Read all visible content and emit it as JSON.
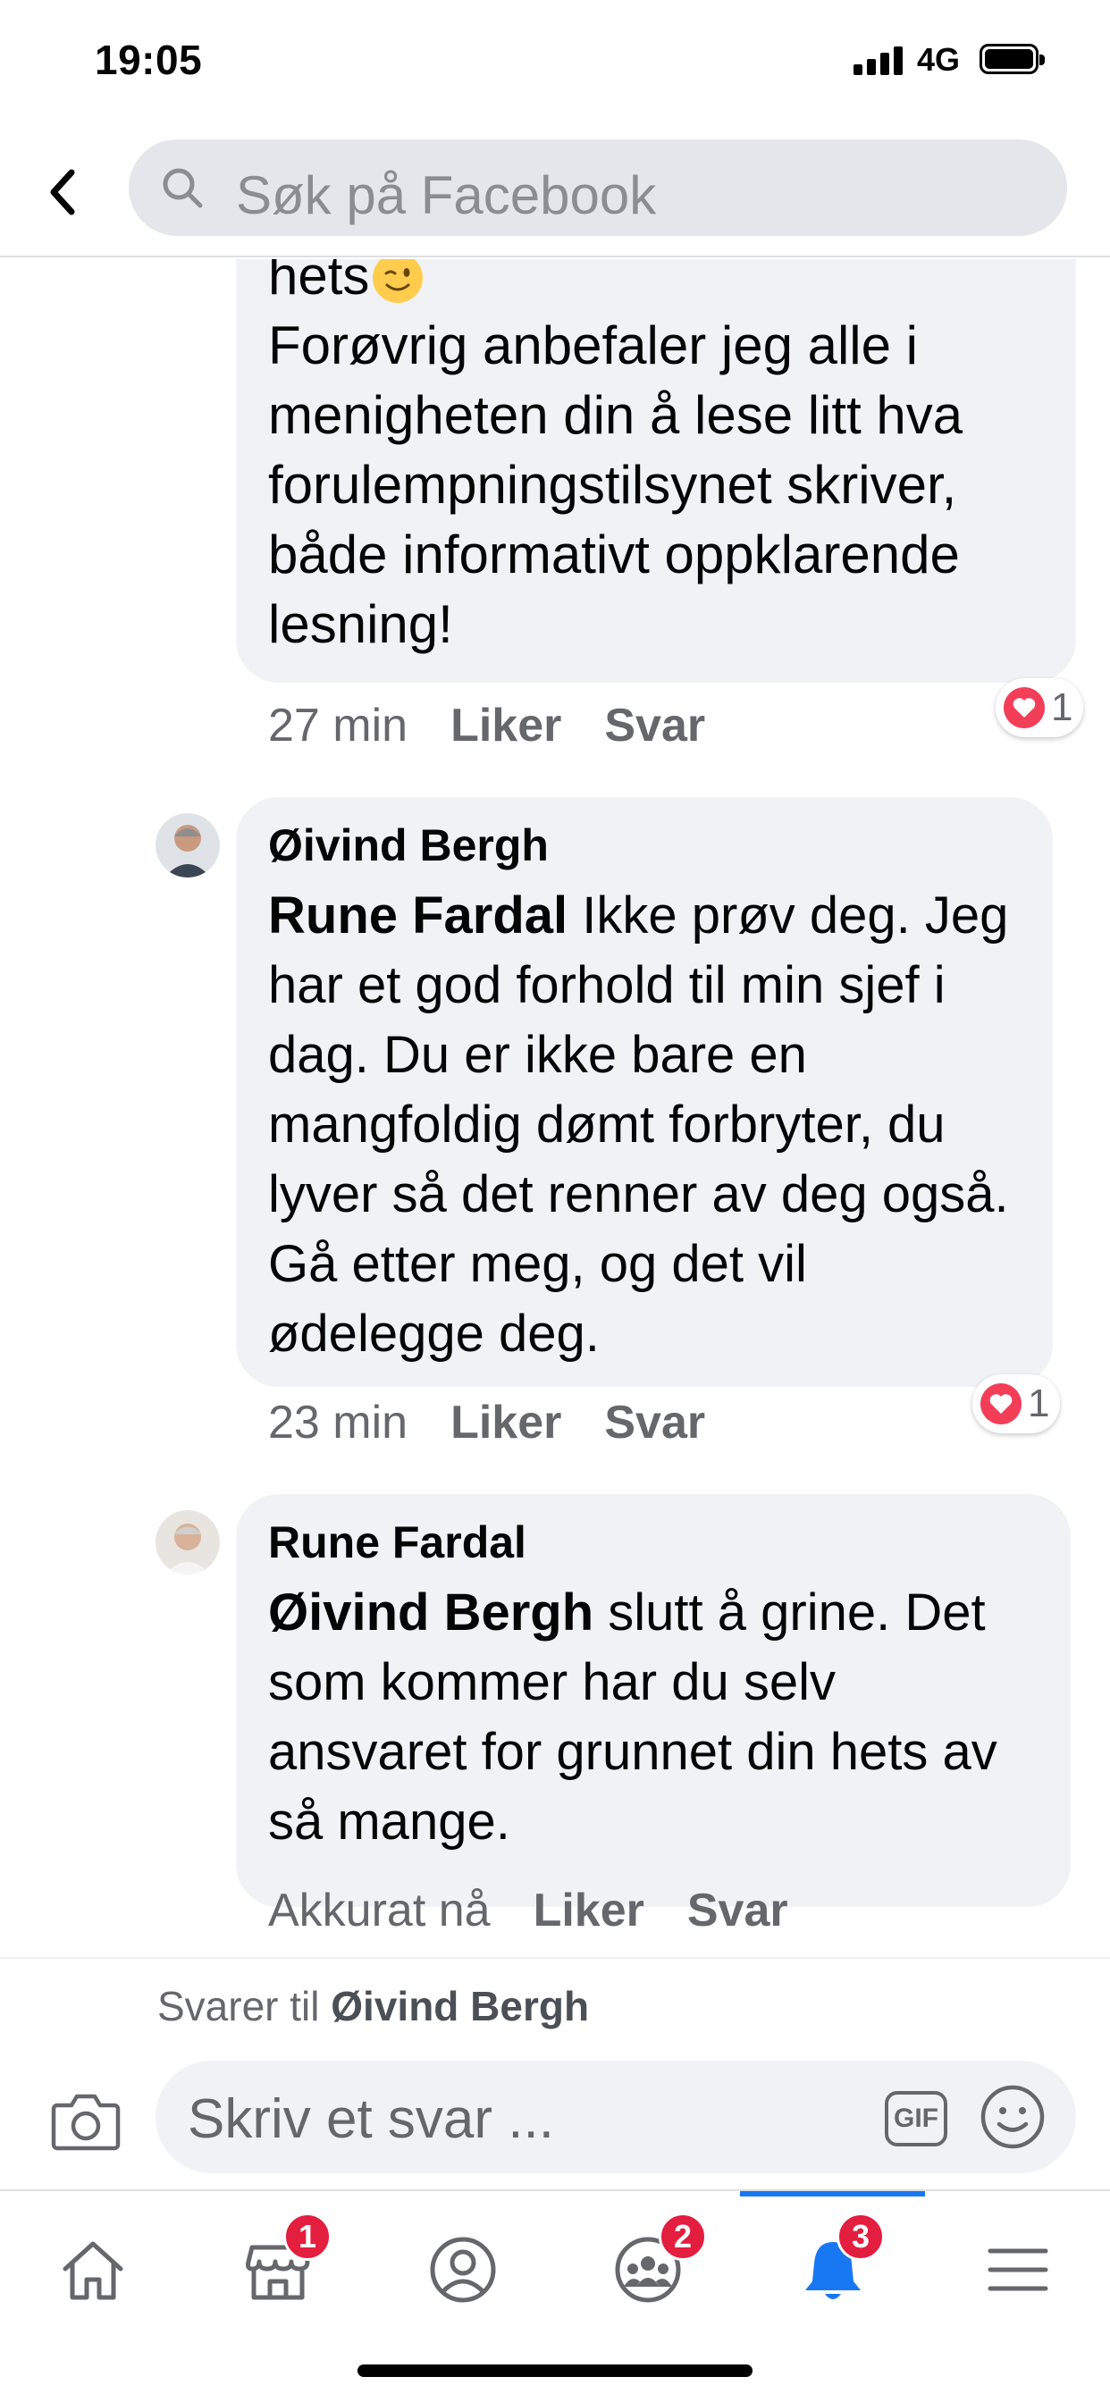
{
  "status_bar": {
    "time": "19:05",
    "network": "4G"
  },
  "header": {
    "search_placeholder": "Søk på Facebook"
  },
  "comments": [
    {
      "author": "",
      "text_first_line": "hets",
      "text": "Forøvrig anbefaler jeg alle i menigheten din å lese litt hva forulempningstilsynet skriver, både informativt oppklarende lesning!",
      "time": "27 min",
      "like_label": "Liker",
      "reply_label": "Svar",
      "reaction_count": "1"
    },
    {
      "author": "Øivind Bergh",
      "mention": "Rune Fardal",
      "text": " Ikke prøv deg. Jeg har et god forhold til min sjef i dag. Du er ikke bare en mangfoldig dømt forbryter, du lyver så det renner av deg også. Gå etter meg, og det vil ødelegge deg.",
      "time": "23 min",
      "like_label": "Liker",
      "reply_label": "Svar",
      "reaction_count": "1"
    },
    {
      "author": "Rune Fardal",
      "mention": "Øivind Bergh",
      "text": " slutt å grine. Det som kommer har du selv ansvaret for grunnet din hets av så mange.",
      "time": "Akkurat nå",
      "like_label": "Liker",
      "reply_label": "Svar"
    }
  ],
  "reply_bar": {
    "prefix": "Svarer til ",
    "name": "Øivind Bergh"
  },
  "composer": {
    "placeholder": "Skriv et svar ...",
    "gif_label": "GIF"
  },
  "tabbar": {
    "badges": {
      "marketplace": "1",
      "groups": "2",
      "notifications": "3"
    }
  },
  "colors": {
    "accent": "#1877f2",
    "badge": "#e41e3f",
    "bubble": "#f0f2f5",
    "reaction_heart": "#f33e58"
  }
}
